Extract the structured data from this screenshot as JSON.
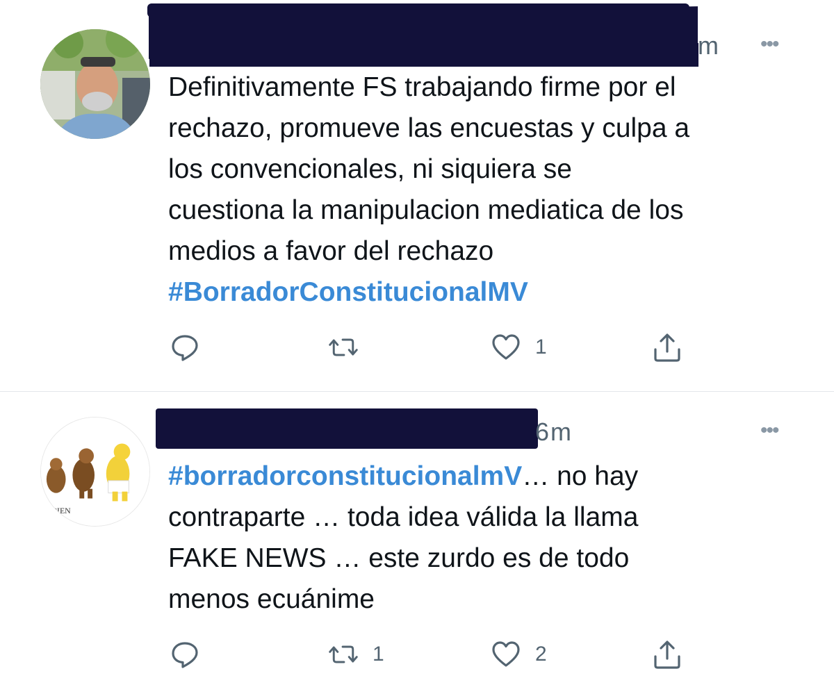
{
  "tweets": [
    {
      "time": "m",
      "more_label": "•••",
      "text_lines": [
        "Definitivamente FS trabajando firme por el",
        "rechazo, promueve las encuestas y culpa a",
        "los convencionales, ni siquiera se",
        "cuestiona la manipulacion mediatica de los",
        "medios a favor del rechazo"
      ],
      "hashtag": "#BorradorConstitucionalMV",
      "actions": {
        "reply_count": "",
        "retweet_count": "",
        "like_count": "1",
        "share_count": ""
      },
      "icons": {
        "reply": "reply-icon",
        "retweet": "retweet-icon",
        "like": "heart-icon",
        "share": "share-icon"
      }
    },
    {
      "time": "m",
      "time_prefix": "6",
      "more_label": "•••",
      "hashtag": "#borradorconstitucionalmV",
      "text_first_suffix": "… no hay",
      "text_lines": [
        "contraparte … toda idea válida la llama",
        "FAKE NEWS … este zurdo es de todo",
        "menos ecuánime"
      ],
      "avatar_caption": "APIEN",
      "actions": {
        "reply_count": "",
        "retweet_count": "1",
        "like_count": "2",
        "share_count": ""
      },
      "icons": {
        "reply": "reply-icon",
        "retweet": "retweet-icon",
        "like": "heart-icon",
        "share": "share-icon"
      }
    }
  ],
  "colors": {
    "hashtag": "#3a8ad6",
    "redaction": "#12113a",
    "muted": "#536471"
  }
}
